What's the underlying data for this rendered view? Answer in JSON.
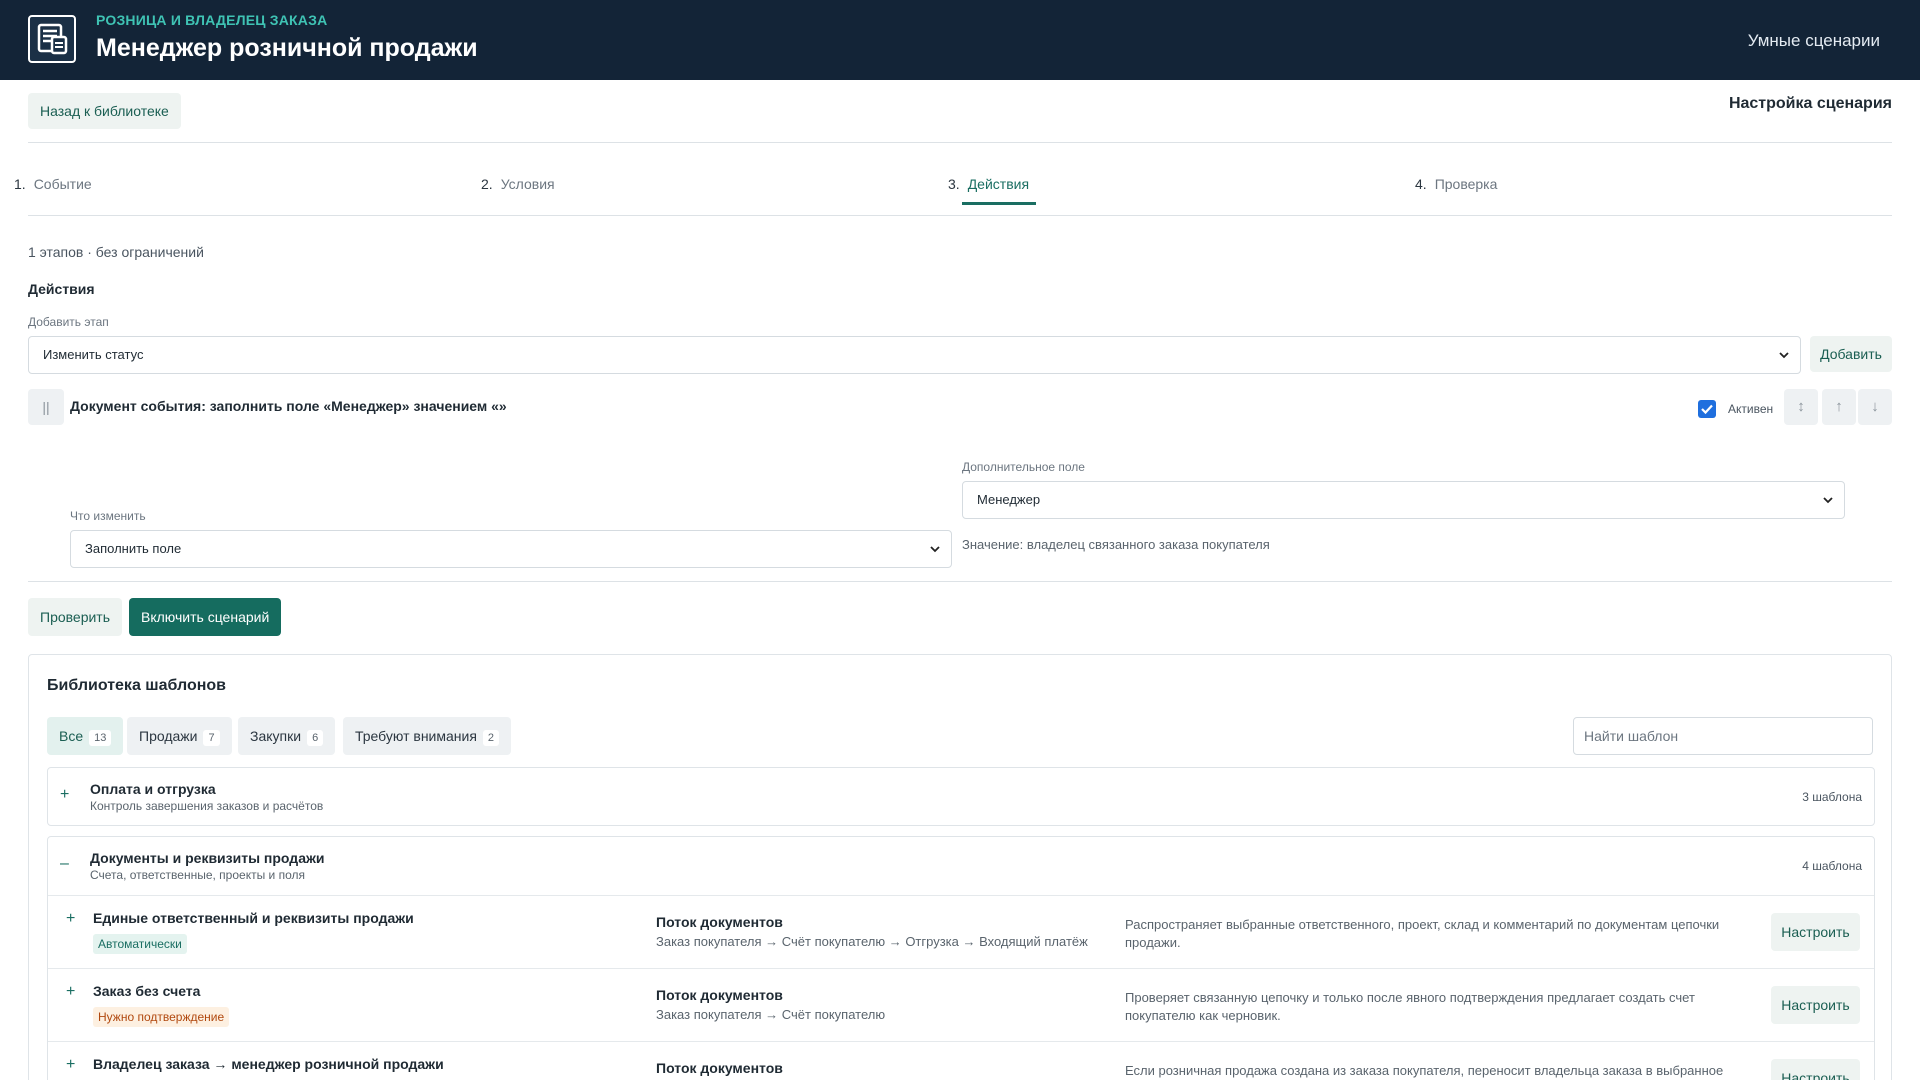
{
  "header": {
    "eyebrow": "РОЗНИЦА И ВЛАДЕЛЕЦ ЗАКАЗА",
    "title": "Менеджер розничной продажи",
    "nav_link": "Умные сценарии"
  },
  "toolbar": {
    "back_label": "Назад к библиотеке",
    "config_title": "Настройка сценария"
  },
  "steps": [
    {
      "num": "1.",
      "label": "Событие"
    },
    {
      "num": "2.",
      "label": "Условия"
    },
    {
      "num": "3.",
      "label": "Действия"
    },
    {
      "num": "4.",
      "label": "Проверка"
    }
  ],
  "meta": "1 этапов · без ограничений",
  "actions": {
    "title": "Действия",
    "add_stage_label": "Добавить этап",
    "add_stage_value": "Изменить статус",
    "add_button": "Добавить",
    "card": {
      "handle": "||",
      "title": "Документ события: заполнить поле «Менеджер» значением «»",
      "active_label": "Активен",
      "active_checked": true,
      "what_label": "Что изменить",
      "what_value": "Заполнить поле",
      "extra_label": "Дополнительное поле",
      "extra_value": "Менеджер",
      "value_hint": "Значение: владелец связанного заказа покупателя"
    },
    "check_button": "Проверить",
    "enable_button": "Включить сценарий"
  },
  "library": {
    "title": "Библиотека шаблонов",
    "filters": [
      {
        "label": "Все",
        "count": "13"
      },
      {
        "label": "Продажи",
        "count": "7"
      },
      {
        "label": "Закупки",
        "count": "6"
      },
      {
        "label": "Требуют внимания",
        "count": "2"
      }
    ],
    "search_placeholder": "Найти шаблон",
    "groups": [
      {
        "toggle": "+",
        "title": "Оплата и отгрузка",
        "subtitle": "Контроль завершения заказов и расчётов",
        "count": "3 шаблона"
      },
      {
        "toggle": "–",
        "title": "Документы и реквизиты продажи",
        "subtitle": "Счета, ответственные, проекты и поля",
        "count": "4 шаблона"
      }
    ],
    "templates": [
      {
        "toggle": "+",
        "title": "Единые ответственный и реквизиты продажи",
        "badge": "Автоматически",
        "flow_title": "Поток документов",
        "flow_path": "Заказ покупателя → Счёт покупателю → Отгрузка → Входящий платёж",
        "description": "Распространяет выбранные ответственного, проект, склад и комментарий по документам цепочки продажи.",
        "button": "Настроить"
      },
      {
        "toggle": "+",
        "title": "Заказ без счета",
        "badge": "Нужно подтверждение",
        "flow_title": "Поток документов",
        "flow_path": "Заказ покупателя → Счёт покупателю",
        "description": "Проверяет связанную цепочку и только после явного подтверждения предлагает создать счет покупателю как черновик.",
        "button": "Настроить"
      },
      {
        "toggle": "+",
        "title": "Владелец заказа → менеджер розничной продажи",
        "flow_title": "Поток документов",
        "description": "Если розничная продажа создана из заказа покупателя, переносит владельца заказа в выбранное поле",
        "button": "Настроить"
      }
    ]
  },
  "colors": {
    "header_bg": "#132437",
    "accent": "#156c5f",
    "eyebrow": "#3fc3b4",
    "badge_auto_bg": "#e4f3ef",
    "badge_need_bg": "#fdf0e1",
    "checkbox": "#1f6fde"
  },
  "icons": {
    "logo": "documents-icon",
    "chevron": "chevron-down-icon",
    "sort": "sort-icon",
    "up": "arrow-up-icon",
    "down": "arrow-down-icon"
  }
}
